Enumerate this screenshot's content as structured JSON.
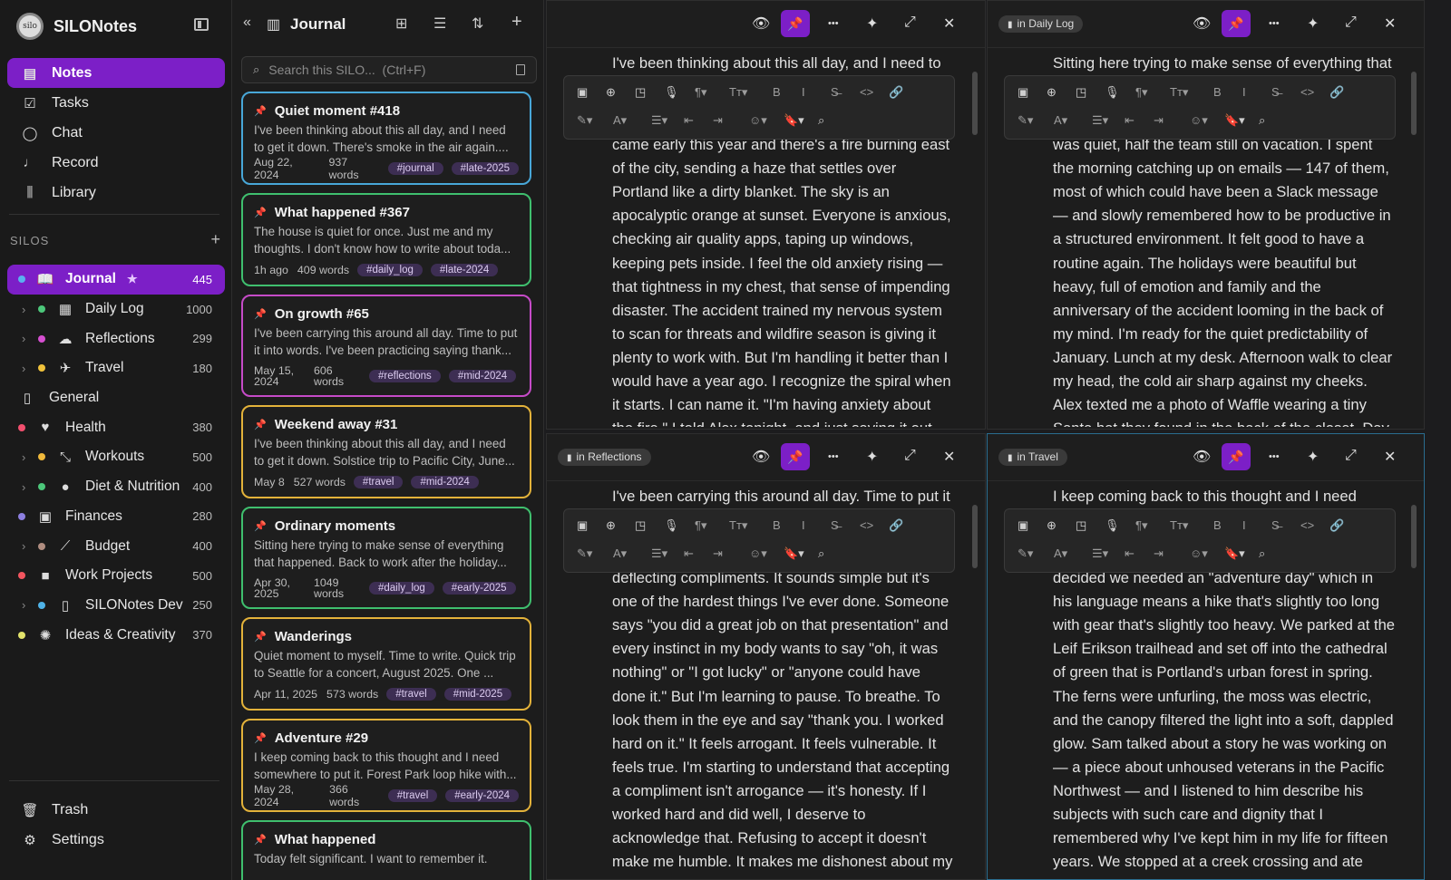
{
  "app": {
    "name": "SILONotes",
    "logo_text": "silo"
  },
  "nav": [
    {
      "label": "Notes",
      "icon": "notes-icon",
      "glyph": "▤",
      "active": true
    },
    {
      "label": "Tasks",
      "icon": "checkbox-icon",
      "glyph": "☑"
    },
    {
      "label": "Chat",
      "icon": "chat-bubble-icon",
      "glyph": "◯"
    },
    {
      "label": "Record",
      "icon": "microphone-icon",
      "glyph": "♩"
    },
    {
      "label": "Library",
      "icon": "library-icon",
      "glyph": "⫼"
    }
  ],
  "silos_header": "SILOS",
  "silos": [
    {
      "name": "Journal",
      "count": "445",
      "dot": "#5ab0f0",
      "icon": "book-icon",
      "glyph": "📖",
      "level": 0,
      "active": true,
      "star": true
    },
    {
      "name": "Daily Log",
      "count": "1000",
      "dot": "#4cc77a",
      "icon": "calendar-icon",
      "glyph": "▦",
      "level": 1
    },
    {
      "name": "Reflections",
      "count": "299",
      "dot": "#d64fd1",
      "icon": "thought-bubble-icon",
      "glyph": "☁",
      "level": 1
    },
    {
      "name": "Travel",
      "count": "180",
      "dot": "#f0c23b",
      "icon": "airplane-icon",
      "glyph": "✈",
      "level": 1
    },
    {
      "name": "General",
      "count": "",
      "dot": "",
      "icon": "notebook-icon",
      "glyph": "▯",
      "level": 0
    },
    {
      "name": "Health",
      "count": "380",
      "dot": "#f24f6e",
      "icon": "heart-pulse-icon",
      "glyph": "♥",
      "level": 0
    },
    {
      "name": "Workouts",
      "count": "500",
      "dot": "#f0b93b",
      "icon": "dumbbell-icon",
      "glyph": "⤡",
      "level": 1
    },
    {
      "name": "Diet & Nutrition",
      "count": "400",
      "dot": "#4cc77a",
      "icon": "apple-icon",
      "glyph": "●",
      "level": 1
    },
    {
      "name": "Finances",
      "count": "280",
      "dot": "#8d7fe0",
      "icon": "banknote-icon",
      "glyph": "▣",
      "level": 0
    },
    {
      "name": "Budget",
      "count": "400",
      "dot": "#b08d80",
      "icon": "line-chart-icon",
      "glyph": "⟋",
      "level": 1
    },
    {
      "name": "Work Projects",
      "count": "500",
      "dot": "#f2555f",
      "icon": "briefcase-icon",
      "glyph": "■",
      "level": 0
    },
    {
      "name": "SILONotes Dev",
      "count": "250",
      "dot": "#4fb3e8",
      "icon": "phone-icon",
      "glyph": "▯",
      "level": 1
    },
    {
      "name": "Ideas & Creativity",
      "count": "370",
      "dot": "#e2e36b",
      "icon": "lightbulb-icon",
      "glyph": "✺",
      "level": 0
    }
  ],
  "bottom_nav": [
    {
      "label": "Trash",
      "icon": "trash-icon",
      "glyph": "🗑"
    },
    {
      "label": "Settings",
      "icon": "gear-icon",
      "glyph": "⚙"
    }
  ],
  "list": {
    "title": "Journal",
    "search_placeholder": "Search this SILO...  (Ctrl+F)",
    "cards": [
      {
        "title": "Quiet moment #418",
        "excerpt": "I've been thinking about this all day, and I need to get it down. There's smoke in the air again....",
        "date": "Aug 22, 2024",
        "words": "937 words",
        "tags": [
          "#journal",
          "#late-2025"
        ],
        "color": "#48a7d8"
      },
      {
        "title": "What happened #367",
        "excerpt": "The house is quiet for once. Just me and my thoughts. I don't know how to write about toda...",
        "date": "1h ago",
        "words": "409 words",
        "tags": [
          "#daily_log",
          "#late-2024"
        ],
        "color": "#3fbf6e"
      },
      {
        "title": "On growth #65",
        "excerpt": "I've been carrying this around all day. Time to put it into words. I've been practicing saying thank...",
        "date": "May 15, 2024",
        "words": "606 words",
        "tags": [
          "#reflections",
          "#mid-2024"
        ],
        "color": "#c64bc8",
        "tall": true
      },
      {
        "title": "Weekend away #31",
        "excerpt": "I've been thinking about this all day, and I need to get it down. Solstice trip to Pacific City, June...",
        "date": "May 8",
        "words": "527 words",
        "tags": [
          "#travel",
          "#mid-2024"
        ],
        "color": "#e3b23a"
      },
      {
        "title": "Ordinary moments",
        "excerpt": "Sitting here trying to make sense of everything that happened. Back to work after the holiday...",
        "date": "Apr 30, 2025",
        "words": "1049 words",
        "tags": [
          "#daily_log",
          "#early-2025"
        ],
        "color": "#3fbf6e",
        "tall": true
      },
      {
        "title": "Wanderings",
        "excerpt": "Quiet moment to myself. Time to write. Quick trip to Seattle for a concert, August 2025. One ...",
        "date": "Apr 11, 2025",
        "words": "573 words",
        "tags": [
          "#travel",
          "#mid-2025"
        ],
        "color": "#e3b23a"
      },
      {
        "title": "Adventure #29",
        "excerpt": "I keep coming back to this thought and I need somewhere to put it. Forest Park loop hike with...",
        "date": "May 28, 2024",
        "words": "366 words",
        "tags": [
          "#travel",
          "#early-2024"
        ],
        "color": "#e3b23a"
      },
      {
        "title": "What happened",
        "excerpt": "Today felt significant. I want to remember it.",
        "date": "",
        "words": "",
        "tags": [],
        "color": "#3fbf6e"
      }
    ]
  },
  "editors": [
    {
      "chip": "",
      "first_line": "I've been thinking about this all day, and I need to",
      "text": "came early this year and there's a fire burning east of the city, sending a haze that settles over Portland like a dirty blanket. The sky is an apocalyptic orange at sunset. Everyone is anxious, checking air quality apps, taping up windows, keeping pets inside. I feel the old anxiety rising — that tightness in my chest, that sense of impending disaster. The accident trained my nervous system to scan for threats and wildfire season is giving it plenty to work with. But I'm handling it better than I would have a year ago. I recognize the spiral when it starts. I can name it. \"I'm having anxiety about the fire.\" I told Alex tonight, and just saying it out loud"
    },
    {
      "chip": "in Daily Log",
      "first_line": "Sitting here trying to make sense of everything that",
      "text": "was quiet, half the team still on vacation. I spent the morning catching up on emails — 147 of them, most of which could have been a Slack message — and slowly remembered how to be productive in a structured environment. It felt good to have a routine again. The holidays were beautiful but heavy, full of emotion and family and the anniversary of the accident looming in the back of my mind. I'm ready for the quiet predictability of January. Lunch at my desk. Afternoon walk to clear my head, the cold air sharp against my cheeks. Alex texted me a photo of Waffle wearing a tiny Santa hat they found in the back of the closet. Day made."
    },
    {
      "chip": "in Reflections",
      "first_line": "I've been carrying this around all day. Time to put it",
      "text": "deflecting compliments. It sounds simple but it's one of the hardest things I've ever done. Someone says \"you did a great job on that presentation\" and every instinct in my body wants to say \"oh, it was nothing\" or \"I got lucky\" or \"anyone could have done it.\" But I'm learning to pause. To breathe. To look them in the eye and say \"thank you. I worked hard on it.\" It feels arrogant. It feels vulnerable. It feels true. I'm starting to understand that accepting a compliment isn't arrogance — it's honesty. If I worked hard and did well, I deserve to acknowledge that. Refusing to accept it doesn't make me humble. It makes me dishonest about my"
    },
    {
      "chip": "in Travel",
      "first_line": "I keep coming back to this thought and I need",
      "text": "decided we needed an \"adventure day\" which in his language means a hike that's slightly too long with gear that's slightly too heavy. We parked at the Leif Erikson trailhead and set off into the cathedral of green that is Portland's urban forest in spring. The ferns were unfurling, the moss was electric, and the canopy filtered the light into a soft, dappled glow. Sam talked about a story he was working on — a piece about unhoused veterans in the Pacific Northwest — and I listened to him describe his subjects with such care and dignity that I remembered why I've kept him in my life for fifteen years. We stopped at a creek crossing and ate"
    }
  ]
}
